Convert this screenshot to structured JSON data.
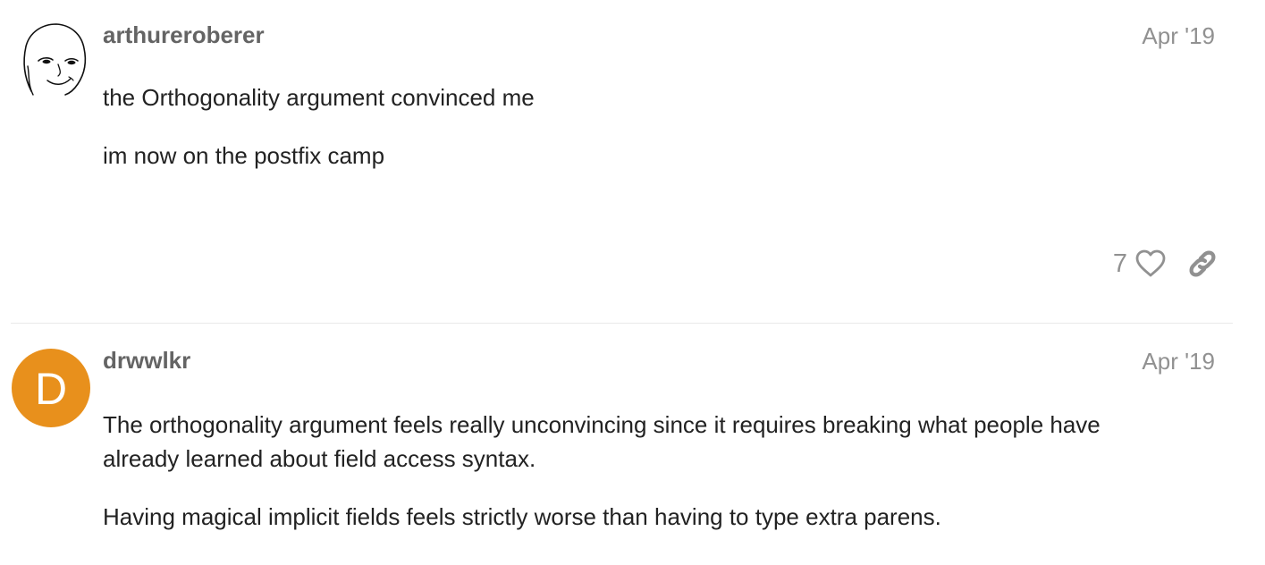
{
  "posts": [
    {
      "username": "arthureroberer",
      "date": "Apr '19",
      "avatar_icon": "wojak-face-avatar",
      "paragraphs": [
        "the Orthogonality argument convinced me",
        "im now on the postfix camp"
      ],
      "like_count": "7"
    },
    {
      "username": "drwwlkr",
      "date": "Apr '19",
      "avatar_letter": "D",
      "avatar_color": "#e8901c",
      "paragraphs": [
        "The orthogonality argument feels really unconvincing since it requires breaking what people have already learned about field access syntax.",
        "Having magical implicit fields feels strictly worse than having to type extra parens."
      ]
    }
  ],
  "icons": {
    "like": "heart-icon",
    "share": "link-icon"
  }
}
